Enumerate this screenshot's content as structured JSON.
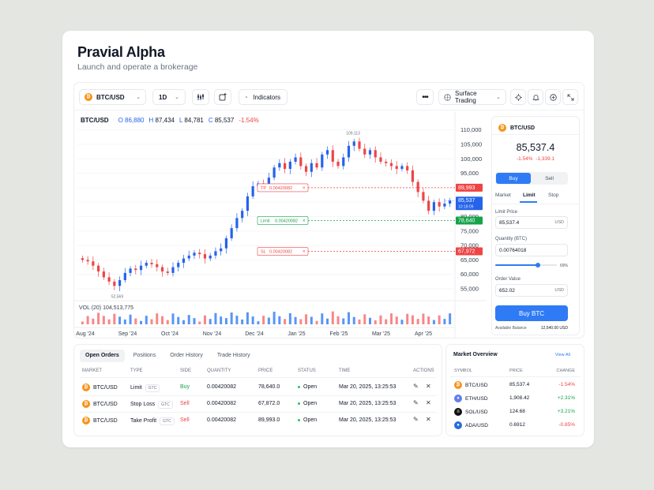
{
  "app": {
    "title": "Pravial Alpha",
    "subtitle": "Launch and operate a brokerage"
  },
  "toolbar": {
    "pair": "BTC/USD",
    "interval": "1D",
    "indicators": "Indicators",
    "surface": "Surface Trading"
  },
  "ohlc": {
    "pair": "BTC/USD",
    "o_label": "O",
    "o": "86,880",
    "h_label": "H",
    "h": "87,434",
    "l_label": "L",
    "l": "84,781",
    "c_label": "C",
    "c": "85,537",
    "chg": "-1.54%"
  },
  "chart_data": {
    "type": "candlestick",
    "y_ticks": [
      "110,000",
      "105,000",
      "100,000",
      "95,000",
      "90,000",
      "85,000",
      "80,000",
      "75,000",
      "70,000",
      "65,000",
      "60,000",
      "55,000"
    ],
    "x_ticks": [
      "Aug '24",
      "Sep '24",
      "Oct '24",
      "Nov '24",
      "Dec '24",
      "Jan '25",
      "Feb '25",
      "Mar '25",
      "Apr '25"
    ],
    "high_label": "109,113",
    "low_label": "52,569",
    "volume_label": "VOL (20) 104,513,775",
    "ylim": [
      52000,
      111000
    ],
    "close_series": [
      65000,
      64500,
      63000,
      61000,
      59000,
      57500,
      56000,
      58000,
      60500,
      62000,
      61500,
      63000,
      64000,
      63500,
      62500,
      61000,
      60500,
      62500,
      64000,
      65500,
      66500,
      67500,
      67000,
      65500,
      66500,
      68000,
      69000,
      72500,
      76000,
      79500,
      82000,
      87000,
      90500,
      91500,
      90500,
      93500,
      97000,
      98500,
      96500,
      99000,
      100500,
      97500,
      95500,
      98500,
      97000,
      101500,
      103000,
      99000,
      97500,
      100500,
      104500,
      106000,
      103500,
      101500,
      103000,
      100500,
      99000,
      98500,
      97500,
      96500,
      97500,
      96000,
      92000,
      88500,
      85500,
      82000,
      85000,
      83500,
      84500,
      85537
    ],
    "price_markers": [
      {
        "label": "89,993",
        "color": "#ef4444"
      },
      {
        "label": "85,537",
        "sub": "10:18:09",
        "color": "#2563eb"
      },
      {
        "label": "78,640",
        "color": "#16a34a"
      },
      {
        "label": "67,972",
        "color": "#ef4444"
      }
    ],
    "order_lines": [
      {
        "type": "TP",
        "qty": "0.00420082",
        "color": "#ef4444"
      },
      {
        "type": "Limit",
        "qty": "0.00420082",
        "color": "#16a34a"
      },
      {
        "type": "SL",
        "qty": "0.00420082",
        "color": "#ef4444"
      }
    ]
  },
  "side": {
    "pair": "BTC/USD",
    "price": "85,537.4",
    "chg_pct": "-1.54%",
    "chg_abs": "-1,339.1",
    "buy": "Buy",
    "sell": "Sell",
    "tabs": [
      "Market",
      "Limit",
      "Stop"
    ],
    "limit_label": "Limit Price",
    "limit_value": "85,537.4",
    "limit_unit": "USD",
    "qty_label": "Quantity (BTC)",
    "qty_value": "0.00764018",
    "slider_pct": "69%",
    "slider_fraction": 0.69,
    "value_label": "Order Value",
    "value_value": "652.02",
    "value_unit": "USD",
    "submit": "Buy BTC",
    "balance_label": "Available Balance",
    "balance_value": "12,540.00 USD"
  },
  "orders": {
    "tabs": [
      "Open Orders",
      "Positions",
      "Order History",
      "Trade History"
    ],
    "headers": [
      "MARKET",
      "TYPE",
      "SIDE",
      "QUANTITY",
      "PRICE",
      "STATUS",
      "TIME",
      "ACTIONS"
    ],
    "rows": [
      {
        "market": "BTC/USD",
        "type": "Limit",
        "tag": "GTC",
        "side": "Buy",
        "qty": "0.00420082",
        "price": "78,640.0",
        "status": "Open",
        "time": "Mar 20, 2025, 13:25:53"
      },
      {
        "market": "BTC/USD",
        "type": "Stop Loss",
        "tag": "GTC",
        "side": "Sell",
        "qty": "0.00420082",
        "price": "67,872.0",
        "status": "Open",
        "time": "Mar 20, 2025, 13:25:53"
      },
      {
        "market": "BTC/USD",
        "type": "Take Profit",
        "tag": "GTC",
        "side": "Sell",
        "qty": "0.00420082",
        "price": "89,993.0",
        "status": "Open",
        "time": "Mar 20, 2025, 13:25:53"
      }
    ]
  },
  "overview": {
    "title": "Market Overview",
    "view_all": "View All",
    "headers": [
      "SYMBOL",
      "PRICE",
      "CHANGE"
    ],
    "rows": [
      {
        "symbol": "BTC/USD",
        "price": "85,537.4",
        "change": "-1.54%",
        "coin": "btc"
      },
      {
        "symbol": "ETH/USD",
        "price": "1,908.42",
        "change": "+2.31%",
        "coin": "eth"
      },
      {
        "symbol": "SOL/USD",
        "price": "124.68",
        "change": "+3.21%",
        "coin": "sol"
      },
      {
        "symbol": "ADA/USD",
        "price": "0.6912",
        "change": "-0.85%",
        "coin": "ada"
      }
    ]
  },
  "colors": {
    "up": "#2563eb",
    "down": "#ef4444",
    "green": "#16a34a",
    "accent": "#2f7bf5"
  }
}
